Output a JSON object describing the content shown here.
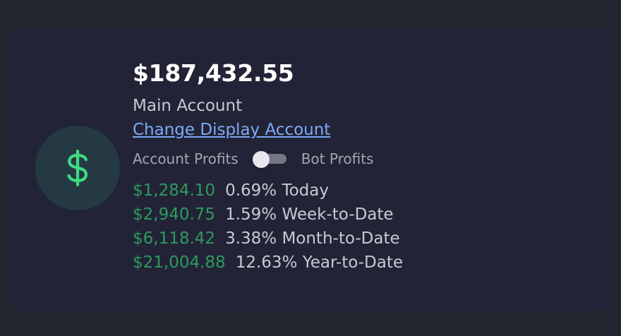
{
  "account": {
    "balance": "$187,432.55",
    "name": "Main Account",
    "change_link": "Change Display Account"
  },
  "toggle": {
    "left_label": "Account Profits",
    "right_label": "Bot Profits",
    "state": "off"
  },
  "stats": [
    {
      "amount": "$1,284.10",
      "percent": "0.69% Today"
    },
    {
      "amount": "$2,940.75",
      "percent": "1.59% Week-to-Date"
    },
    {
      "amount": "$6,118.42",
      "percent": "3.38% Month-to-Date"
    },
    {
      "amount": "$21,004.88",
      "percent": "12.63% Year-to-Date"
    }
  ],
  "icons": {
    "avatar": "dollar-sign-icon"
  },
  "colors": {
    "profit_green": "#2e9a5f",
    "icon_green": "#3ddc84",
    "link_blue": "#7eaaf5",
    "card_bg": "#222336"
  }
}
